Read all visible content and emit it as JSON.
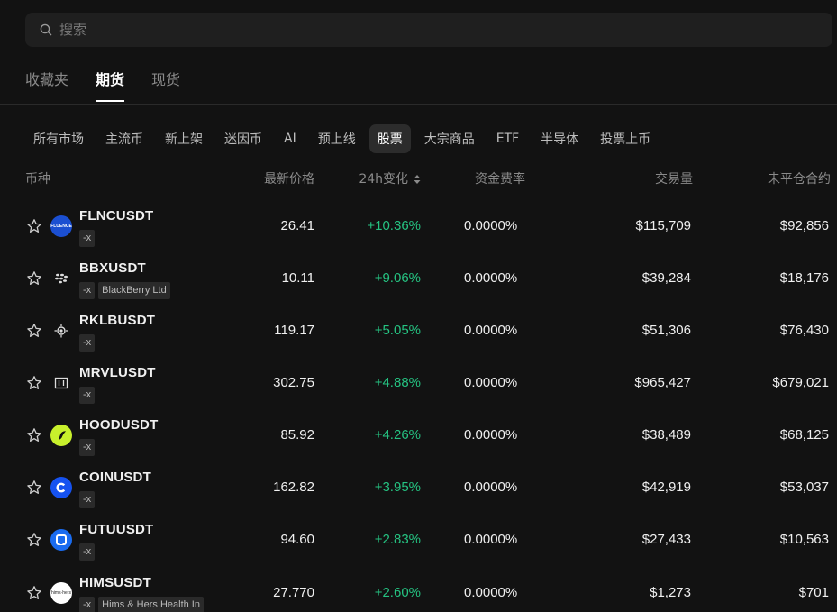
{
  "search": {
    "placeholder": "搜索"
  },
  "top_tabs": [
    {
      "label": "收藏夹",
      "active": false
    },
    {
      "label": "期货",
      "active": true
    },
    {
      "label": "现货",
      "active": false
    }
  ],
  "categories": [
    {
      "label": "所有市场",
      "active": false
    },
    {
      "label": "主流币",
      "active": false
    },
    {
      "label": "新上架",
      "active": false
    },
    {
      "label": "迷因币",
      "active": false
    },
    {
      "label": "AI",
      "active": false
    },
    {
      "label": "预上线",
      "active": false
    },
    {
      "label": "股票",
      "active": true
    },
    {
      "label": "大宗商品",
      "active": false
    },
    {
      "label": "ETF",
      "active": false
    },
    {
      "label": "半导体",
      "active": false
    },
    {
      "label": "投票上币",
      "active": false
    }
  ],
  "table": {
    "headers": {
      "coin": "币种",
      "price": "最新价格",
      "change": "24h变化",
      "funding": "资金费率",
      "volume": "交易量",
      "open_interest": "未平仓合约"
    },
    "rows": [
      {
        "symbol": "FLNCUSDT",
        "tags": [
          "-x"
        ],
        "logo_bg": "#1b4fd1",
        "logo_text": "FLUENCE",
        "price": "26.41",
        "change": "+10.36%",
        "funding": "0.0000%",
        "volume": "$115,709",
        "open_interest": "$92,856"
      },
      {
        "symbol": "BBXUSDT",
        "tags": [
          "-x",
          "BlackBerry Ltd"
        ],
        "logo_bg": "#121212",
        "logo_text": "",
        "price": "10.11",
        "change": "+9.06%",
        "funding": "0.0000%",
        "volume": "$39,284",
        "open_interest": "$18,176"
      },
      {
        "symbol": "RKLBUSDT",
        "tags": [
          "-x"
        ],
        "logo_bg": "#121212",
        "logo_text": "",
        "price": "119.17",
        "change": "+5.05%",
        "funding": "0.0000%",
        "volume": "$51,306",
        "open_interest": "$76,430"
      },
      {
        "symbol": "MRVLUSDT",
        "tags": [
          "-x"
        ],
        "logo_bg": "#121212",
        "logo_text": "",
        "price": "302.75",
        "change": "+4.88%",
        "funding": "0.0000%",
        "volume": "$965,427",
        "open_interest": "$679,021"
      },
      {
        "symbol": "HOODUSDT",
        "tags": [
          "-x"
        ],
        "logo_bg": "#c8f02c",
        "logo_text": "",
        "price": "85.92",
        "change": "+4.26%",
        "funding": "0.0000%",
        "volume": "$38,489",
        "open_interest": "$68,125"
      },
      {
        "symbol": "COINUSDT",
        "tags": [
          "-x"
        ],
        "logo_bg": "#1652f0",
        "logo_text": "",
        "price": "162.82",
        "change": "+3.95%",
        "funding": "0.0000%",
        "volume": "$42,919",
        "open_interest": "$53,037"
      },
      {
        "symbol": "FUTUUSDT",
        "tags": [
          "-x"
        ],
        "logo_bg": "#1a6cf0",
        "logo_text": "",
        "price": "94.60",
        "change": "+2.83%",
        "funding": "0.0000%",
        "volume": "$27,433",
        "open_interest": "$10,563"
      },
      {
        "symbol": "HIMSUSDT",
        "tags": [
          "-x",
          "Hims & Hers Health In"
        ],
        "logo_bg": "#ffffff",
        "logo_text": "hims·hers",
        "price": "27.770",
        "change": "+2.60%",
        "funding": "0.0000%",
        "volume": "$1,273",
        "open_interest": "$701"
      }
    ]
  },
  "colors": {
    "positive": "#25c281",
    "background": "#121212",
    "chip_active": "#2c2c2c"
  }
}
